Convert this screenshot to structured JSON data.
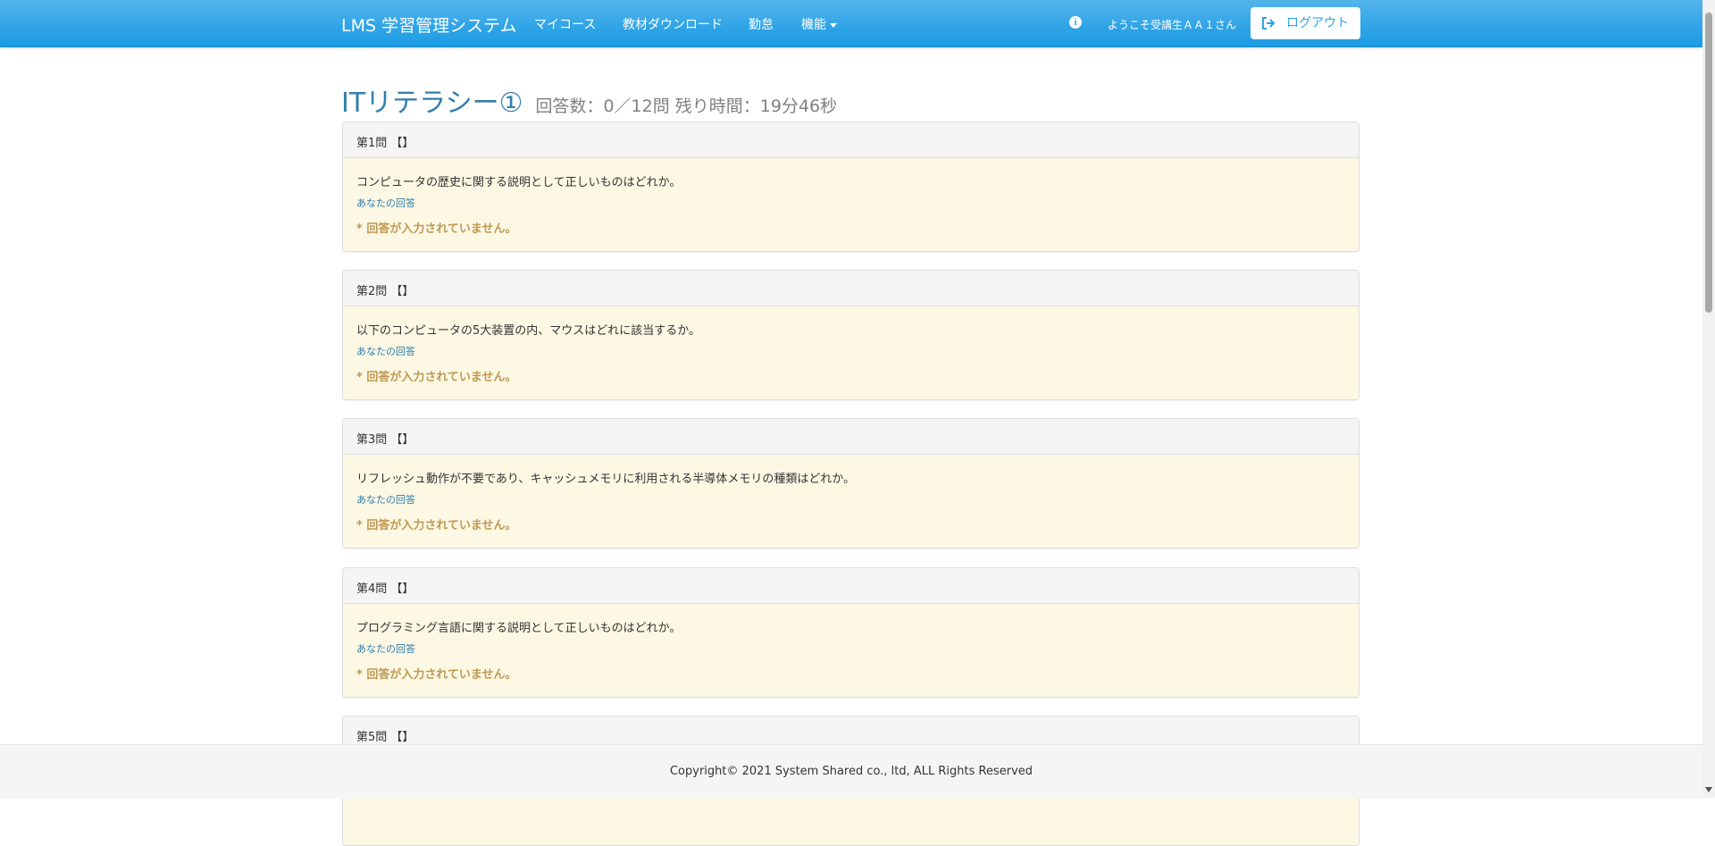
{
  "navbar": {
    "brand": "LMS 学習管理システム",
    "menu": [
      {
        "label": "マイコース"
      },
      {
        "label": "教材ダウンロード"
      },
      {
        "label": "勤怠"
      },
      {
        "label": "機能"
      }
    ],
    "welcome": "ようこそ受講生ＡＡ１さん",
    "logout_label": "ログアウト",
    "info_icon": "info-circle-icon",
    "logout_icon": "sign-out-icon"
  },
  "header": {
    "title": "ITリテラシー①",
    "meta": "回答数：0／12問  残り時間：19分46秒"
  },
  "questions": [
    {
      "heading": "第1問 【】",
      "text": "コンピュータの歴史に関する説明として正しいものはどれか。",
      "answer_label": "あなたの回答",
      "no_answer": "* 回答が入力されていません。"
    },
    {
      "heading": "第2問 【】",
      "text": "以下のコンピュータの5大装置の内、マウスはどれに該当するか。",
      "answer_label": "あなたの回答",
      "no_answer": "* 回答が入力されていません。"
    },
    {
      "heading": "第3問 【】",
      "text": "リフレッシュ動作が不要であり、キャッシュメモリに利用される半導体メモリの種類はどれか。",
      "answer_label": "あなたの回答",
      "no_answer": "* 回答が入力されていません。"
    },
    {
      "heading": "第4問 【】",
      "text": "プログラミング言語に関する説明として正しいものはどれか。",
      "answer_label": "あなたの回答",
      "no_answer": "* 回答が入力されていません。"
    },
    {
      "heading": "第5問 【】"
    }
  ],
  "footer": {
    "copyright": "Copyright© 2021 System Shared co., ltd, ALL Rights Reserved"
  },
  "colors": {
    "navbar": "#2fa4e7",
    "title": "#317eac",
    "panel_body": "#fcf8e3",
    "warning_text": "#c09853"
  }
}
